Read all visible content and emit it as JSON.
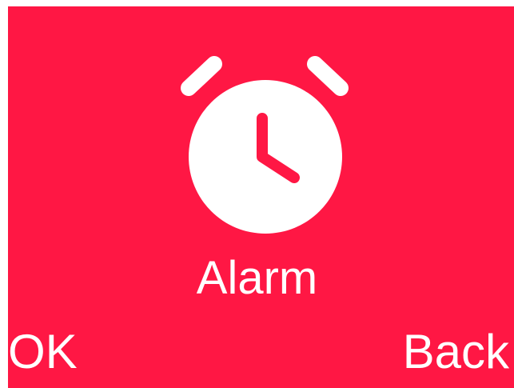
{
  "screen": {
    "background_color": "#FF1744",
    "icon": "alarm-clock-icon",
    "title": "Alarm"
  },
  "softkeys": {
    "left_label": "OK",
    "right_label": "Back"
  }
}
